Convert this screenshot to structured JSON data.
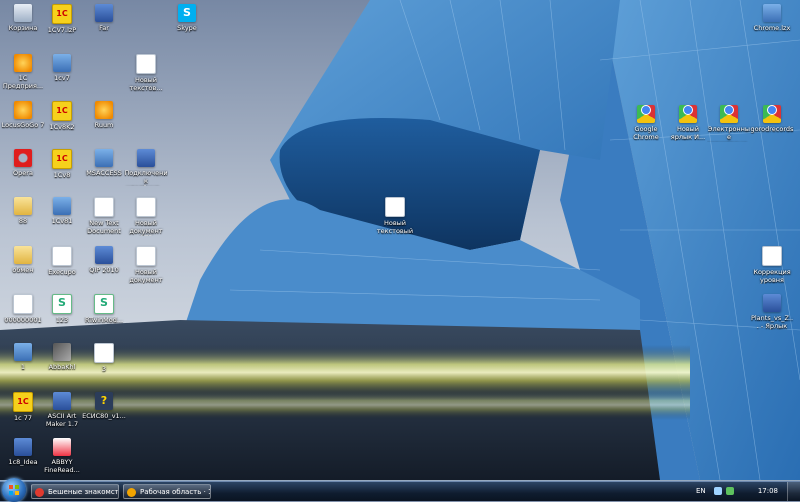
{
  "desktop": {
    "icons": [
      {
        "label": "Корзина",
        "icon": "recycle-bin-icon",
        "name": "icon-recycle-bin"
      },
      {
        "label": "1CV7.lzP",
        "icon": "1c-icon",
        "name": "icon-1cv7"
      },
      {
        "label": "Far",
        "icon": "far-manager-icon",
        "name": "icon-far"
      },
      {
        "label": "Skype",
        "icon": "skype-icon",
        "name": "icon-skype"
      },
      {
        "label": "1С Предприя...",
        "icon": "1c-enterprise-icon",
        "name": "icon-1c-enterprise"
      },
      {
        "label": "1cv7",
        "icon": "shortcut-icon",
        "name": "icon-1cv7-shortcut"
      },
      {
        "label": "Новый текстов...",
        "icon": "text-document-icon",
        "name": "icon-new-text-1"
      },
      {
        "label": "LocusGoGo 7",
        "icon": "orange-app-icon",
        "name": "icon-locus"
      },
      {
        "label": "1Cv8K2",
        "icon": "1c-icon",
        "name": "icon-1cv8k2"
      },
      {
        "label": "Ruum",
        "icon": "app-icon",
        "name": "icon-ruum"
      },
      {
        "label": "Opera",
        "icon": "opera-icon",
        "name": "icon-opera"
      },
      {
        "label": "1Cv8",
        "icon": "1c-icon",
        "name": "icon-1cv8"
      },
      {
        "label": "MSACCESS",
        "icon": "app-icon",
        "name": "icon-msaccess"
      },
      {
        "label": "Подключени к удалённо...",
        "icon": "remote-desktop-icon",
        "name": "icon-remote"
      },
      {
        "label": "88",
        "icon": "folder-icon",
        "name": "icon-folder-88"
      },
      {
        "label": "1Cv81",
        "icon": "shortcut-icon",
        "name": "icon-1cv81"
      },
      {
        "label": "New Text Document",
        "icon": "text-document-icon",
        "name": "icon-new-text-doc"
      },
      {
        "label": "Новый документ RTF",
        "icon": "text-document-icon",
        "name": "icon-new-rtf"
      },
      {
        "label": "Новый текстовый ...",
        "icon": "text-document-icon",
        "name": "icon-new-text-center"
      },
      {
        "label": "обмен",
        "icon": "folder-icon",
        "name": "icon-folder-obmen"
      },
      {
        "label": "Execupo",
        "icon": "text-document-icon",
        "name": "icon-execupo"
      },
      {
        "label": "QIP 2010",
        "icon": "app-icon",
        "name": "icon-qip"
      },
      {
        "label": "Новый документ",
        "icon": "text-document-icon",
        "name": "icon-new-doc"
      },
      {
        "label": "000000001",
        "icon": "text-document-icon",
        "name": "icon-000000001"
      },
      {
        "label": "123",
        "icon": "s-icon",
        "name": "icon-123"
      },
      {
        "label": "RTwinMod...",
        "icon": "s-icon",
        "name": "icon-rtwinmod"
      },
      {
        "label": "1",
        "icon": "app-icon",
        "name": "icon-1"
      },
      {
        "label": "AbbaKhl",
        "icon": "image-icon",
        "name": "icon-abba"
      },
      {
        "label": "3",
        "icon": "text-document-icon",
        "name": "icon-3"
      },
      {
        "label": "1c 77",
        "icon": "1c-icon",
        "name": "icon-1c77"
      },
      {
        "label": "ASCII Art Maker 1.7",
        "icon": "app-icon",
        "name": "icon-ascii"
      },
      {
        "label": "ЕСИС80_v1...",
        "icon": "help-icon",
        "name": "icon-esis"
      },
      {
        "label": "1c8_Idea",
        "icon": "app-icon",
        "name": "icon-1c8-idea"
      },
      {
        "label": "ABBYY FineRead...",
        "icon": "abbyy-icon",
        "name": "icon-abbyy"
      },
      {
        "label": "Chrome.lzx",
        "icon": "app-icon",
        "name": "icon-chrome-lzx"
      },
      {
        "label": "Google Chrome",
        "icon": "chrome-icon",
        "name": "icon-google-chrome"
      },
      {
        "label": "Новый ярлык И...",
        "icon": "chrome-icon",
        "name": "icon-new-shortcut"
      },
      {
        "label": "Электронные регистраци...",
        "icon": "chrome-icon",
        "name": "icon-registrations"
      },
      {
        "label": "gorodrecords",
        "icon": "chrome-icon",
        "name": "icon-gorodrecords"
      },
      {
        "label": "Коррекция уровня",
        "icon": "text-document-icon",
        "name": "icon-correction"
      },
      {
        "label": "Plants_vs_Z... - Ярлык",
        "icon": "app-icon",
        "name": "icon-plants"
      }
    ]
  },
  "taskbar": {
    "buttons": [
      {
        "label": "Бешеные знакомст...",
        "name": "taskbar-item-browser"
      },
      {
        "label": "Рабочая область · 1...",
        "name": "taskbar-item-workspace"
      }
    ],
    "language": "EN",
    "clock": "17:08"
  }
}
